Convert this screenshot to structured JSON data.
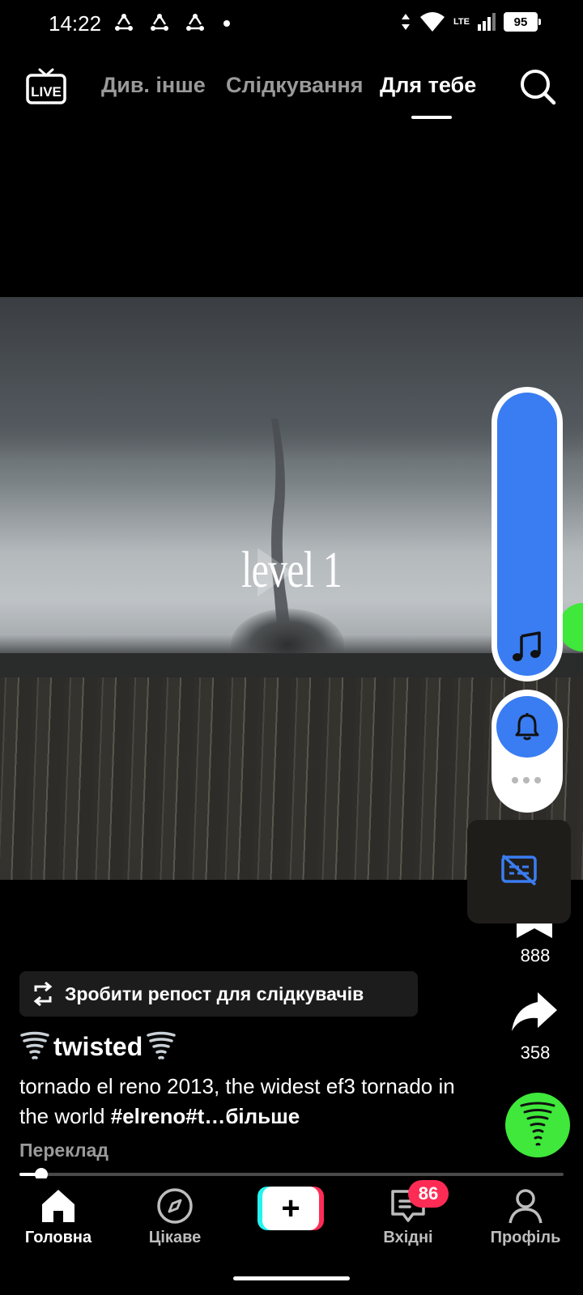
{
  "status_bar": {
    "time": "14:22",
    "network": "LTE",
    "battery": "95",
    "icons": [
      "sync-icon",
      "sync-icon",
      "sync-icon",
      "dot",
      "data-arrows-icon",
      "wifi-icon",
      "signal-icon",
      "battery-icon"
    ]
  },
  "top_nav": {
    "live_label": "LIVE",
    "tabs": [
      {
        "label": "Див. інше"
      },
      {
        "label": "Слідкування"
      },
      {
        "label": "Для тебе"
      }
    ],
    "active_tab": "Для тебе"
  },
  "video": {
    "overlay_text": "level 1"
  },
  "side_actions": {
    "bookmark_count": "888",
    "share_count": "358",
    "icons": [
      "music-icon",
      "bell-icon",
      "more-icon",
      "captions-off-icon",
      "bookmark-icon",
      "share-icon"
    ]
  },
  "repost": {
    "label": "Зробити репост для слідкувачів"
  },
  "post": {
    "author": "twisted",
    "description_text": "tornado el reno 2013, the widest ef3 tornado in the world ",
    "description_tag": "#elreno#t…",
    "more_label": "більше",
    "translate_label": "Переклад",
    "progress": 0.04
  },
  "bottom_nav": {
    "items": [
      {
        "label": "Головна",
        "icon": "home-icon"
      },
      {
        "label": "Цікаве",
        "icon": "compass-icon"
      },
      {
        "label": "",
        "icon": "plus-icon"
      },
      {
        "label": "Вхідні",
        "icon": "inbox-icon"
      },
      {
        "label": "Профіль",
        "icon": "profile-icon"
      }
    ],
    "create_label": "+",
    "inbox_badge": "86"
  },
  "colors": {
    "accent_blue": "#3a7df2",
    "avatar_green": "#3fe83a",
    "badge_red": "#fe2c55",
    "create_cyan": "#25f4ee"
  }
}
